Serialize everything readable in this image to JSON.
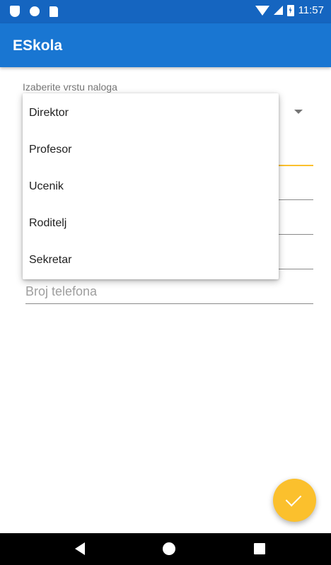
{
  "status_bar": {
    "time": "11:57",
    "icons": [
      "shield-icon",
      "record-icon",
      "sd-card-icon",
      "wifi-icon",
      "signal-icon",
      "battery-icon"
    ]
  },
  "app_bar": {
    "title": "ESkola",
    "color": "#1976d2"
  },
  "form": {
    "account_type_label": "Izaberite vrstu naloga",
    "phone_placeholder": "Broj telefona",
    "accent_color": "#fbc02d"
  },
  "dropdown": {
    "options": [
      "Direktor",
      "Profesor",
      "Ucenik",
      "Roditelj",
      "Sekretar"
    ]
  },
  "fab": {
    "icon": "check-icon",
    "color": "#fbc02d"
  },
  "nav_bar": {
    "icons": [
      "back-icon",
      "home-icon",
      "recents-icon"
    ]
  }
}
